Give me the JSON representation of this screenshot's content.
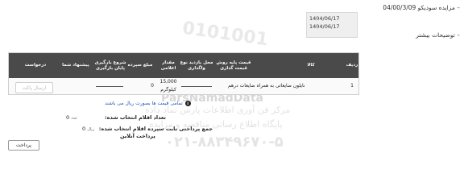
{
  "auction": {
    "bullet": "–",
    "title": "مزایده سودیکو 04/00/3/09"
  },
  "more_info": {
    "bullet": "–",
    "label": "توضیحات بیشتر"
  },
  "dates": {
    "line1": "1404/06/17",
    "line2": "1404/06/17"
  },
  "table": {
    "headers": {
      "row": "ردیف",
      "item": "کالا",
      "base_price": "قیمت پایه روش قیمت گذاری",
      "delivery": "محل بازدید نوع واگذاری",
      "quantity": "مقدار اعلامی",
      "deposit": "مبلغ سپرده",
      "loading_terms": "شروع بارگیری پایان بارگیری",
      "offer": "پیشنهاد شما",
      "request": "درخواست"
    },
    "rows": [
      {
        "row": "1",
        "item": "نایلون ضایعاتی به همراه ضایعات درهم",
        "quantity": "15,000",
        "unit": "کیلوگرم",
        "deposit": "0",
        "send_label": "ارسال پاکت"
      }
    ]
  },
  "note": "تمامی قیمت ها بصورت ریال می باشند",
  "summary": {
    "selected_label": "تعداد اقلام انتخاب شده:",
    "selected_value": "0",
    "selected_unit": "عدد",
    "deposit_label": "جمع پرداختی بابت سپرده اقلام انتخاب شده:",
    "deposit_value": "0",
    "deposit_unit": "ریال",
    "online_label": "پرداخت آنلاین",
    "pay_button": "پرداخت"
  },
  "watermark": {
    "brand": "ParsNamadData",
    "line1": "مرکز فن آوری اطلاعات پارس نماد داده",
    "line2": "پایگاه اطلاع رسانی مناقصه و مزایده",
    "phone": "۰۲۱-۸۸۳۴۹۶۷۰-۵",
    "code": "0101001"
  }
}
